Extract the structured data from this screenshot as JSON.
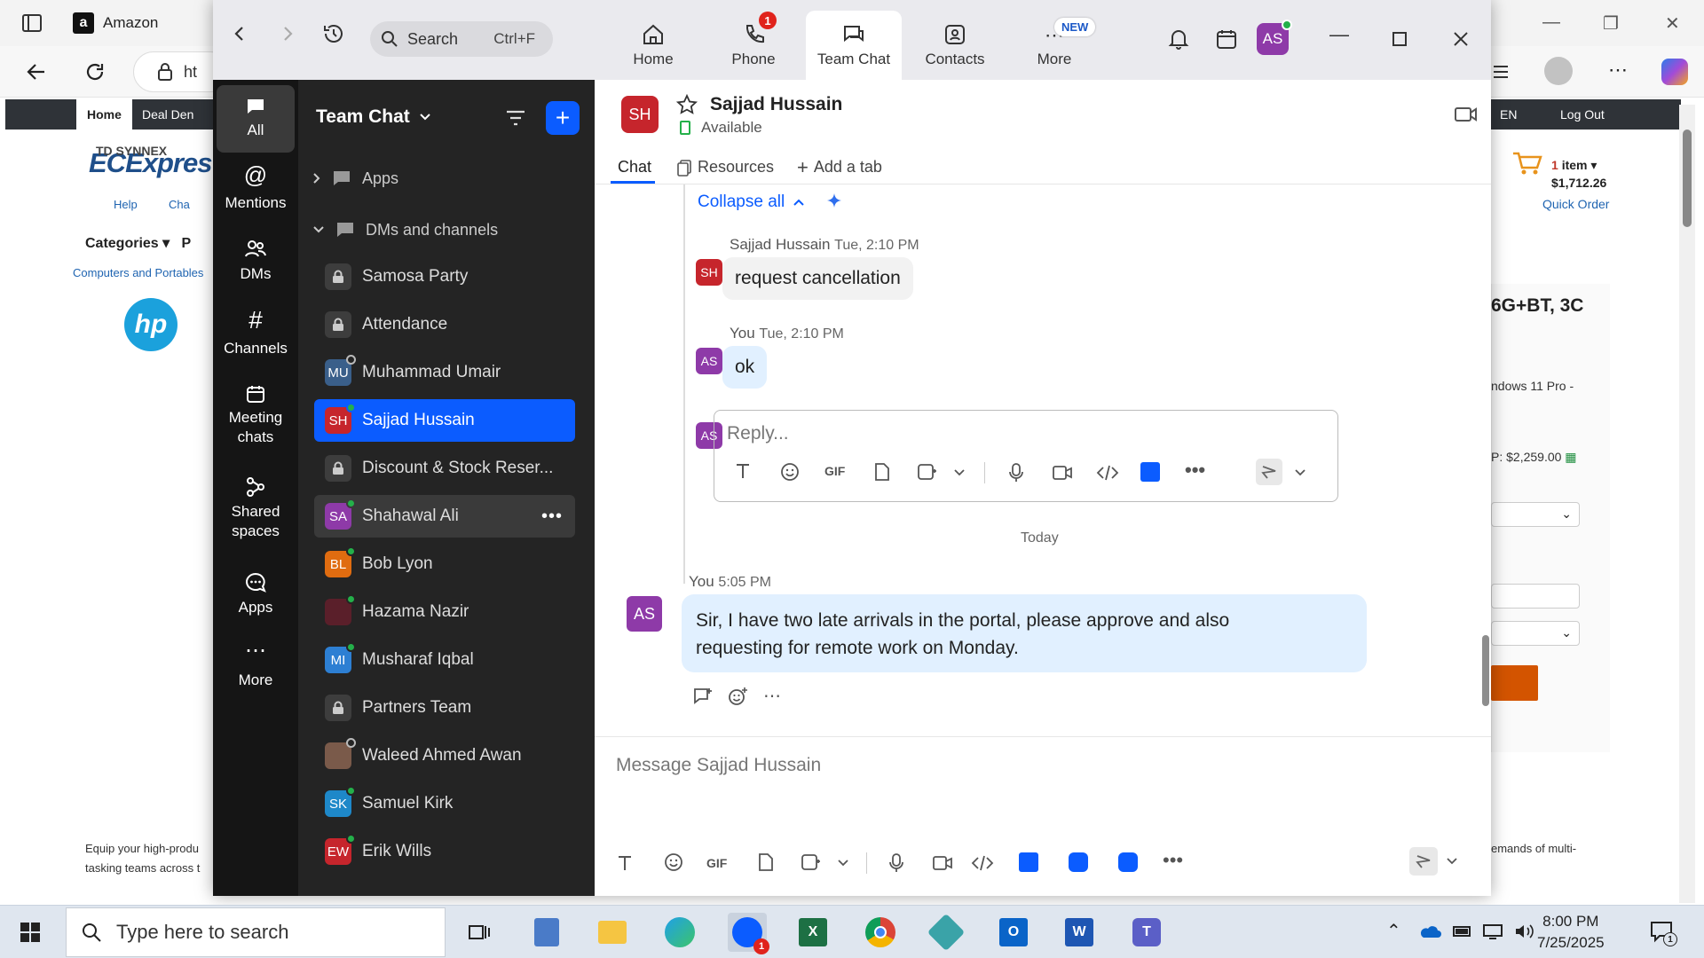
{
  "browser": {
    "tab_title": "Amazon",
    "url_fragment": "ht",
    "site": {
      "nav_home": "Home",
      "nav_deal_den": "Deal Den",
      "nav_right": "EN",
      "nav_logout": "Log Out",
      "logo_small": "TD SYNNEX",
      "logo": "ECExpres",
      "help": "Help",
      "chat": "Cha",
      "categories": "Categories",
      "categories_next": "P",
      "breadcrumb": "Computers and Portables",
      "cart_count": "1",
      "cart_label": "item",
      "cart_total": "$1,712.26",
      "quick_order": "Quick Order",
      "product_title": "6G+BT, 3C",
      "product_os": "ndows 11 Pro -",
      "product_price": "P: $2,259.00",
      "desc_left_1": "Equip your high-produ",
      "desc_left_2": "tasking teams across t",
      "desc_right": "emands of multi-"
    }
  },
  "zoom": {
    "search": {
      "placeholder": "Search",
      "shortcut": "Ctrl+F"
    },
    "tabs": [
      {
        "label": "Home"
      },
      {
        "label": "Phone",
        "badge": "1"
      },
      {
        "label": "Team Chat"
      },
      {
        "label": "Contacts"
      },
      {
        "label": "More",
        "badge": "NEW"
      }
    ],
    "user_initials": "AS",
    "rail": [
      {
        "label": "All"
      },
      {
        "label": "Mentions"
      },
      {
        "label": "DMs"
      },
      {
        "label": "Channels"
      },
      {
        "label": "Meeting chats"
      },
      {
        "label": "Shared spaces"
      },
      {
        "label": "Apps"
      },
      {
        "label": "More"
      }
    ],
    "list": {
      "title": "Team Chat",
      "sections": [
        {
          "label": "Apps"
        },
        {
          "label": "DMs and channels"
        }
      ],
      "items": [
        {
          "name": "Samosa Party",
          "initials": "",
          "color": "#3d3d3d"
        },
        {
          "name": "Attendance",
          "initials": "",
          "color": "#3d3d3d"
        },
        {
          "name": "Muhammad Umair",
          "initials": "MU",
          "color": "#3a5f8a"
        },
        {
          "name": "Sajjad Hussain",
          "initials": "SH",
          "color": "#c6252c"
        },
        {
          "name": "Discount & Stock Reser...",
          "initials": "",
          "color": "#3d3d3d"
        },
        {
          "name": "Shahawal Ali",
          "initials": "SA",
          "color": "#8e3aa8"
        },
        {
          "name": "Bob Lyon",
          "initials": "BL",
          "color": "#e06c10"
        },
        {
          "name": "Hazama Nazir",
          "initials": "",
          "color": "#5a1f2a"
        },
        {
          "name": "Musharaf Iqbal",
          "initials": "MI",
          "color": "#2d7fd3"
        },
        {
          "name": "Partners Team",
          "initials": "",
          "color": "#3d3d3d"
        },
        {
          "name": "Waleed Ahmed Awan",
          "initials": "",
          "color": "#7a5a4a"
        },
        {
          "name": "Samuel Kirk",
          "initials": "SK",
          "color": "#1e88c9"
        },
        {
          "name": "Erik Wills",
          "initials": "EW",
          "color": "#c6252c"
        }
      ]
    },
    "chat": {
      "contact_name": "Sajjad Hussain",
      "contact_initials": "SH",
      "status": "Available",
      "tabs": {
        "chat": "Chat",
        "resources": "Resources",
        "add": "Add a tab"
      },
      "collapse": "Collapse all",
      "messages": [
        {
          "author": "Sajjad Hussain",
          "initials": "SH",
          "time": "Tue, 2:10 PM",
          "text": "request cancellation"
        },
        {
          "author": "You",
          "initials": "AS",
          "time": "Tue, 2:10 PM",
          "text": "ok"
        }
      ],
      "reply_placeholder": "Reply...",
      "gif": "GIF",
      "day_divider": "Today",
      "latest": {
        "author": "You",
        "initials": "AS",
        "time": "5:05 PM",
        "line1": "Sir, I have two late arrivals in the portal, please approve and also",
        "line2": "requesting for remote work on Monday."
      },
      "compose_placeholder": "Message Sajjad Hussain"
    }
  },
  "taskbar": {
    "search_placeholder": "Type here to search",
    "time": "8:00 PM",
    "date": "7/25/2025",
    "notif_count": "1",
    "zoom_badge": "1"
  }
}
